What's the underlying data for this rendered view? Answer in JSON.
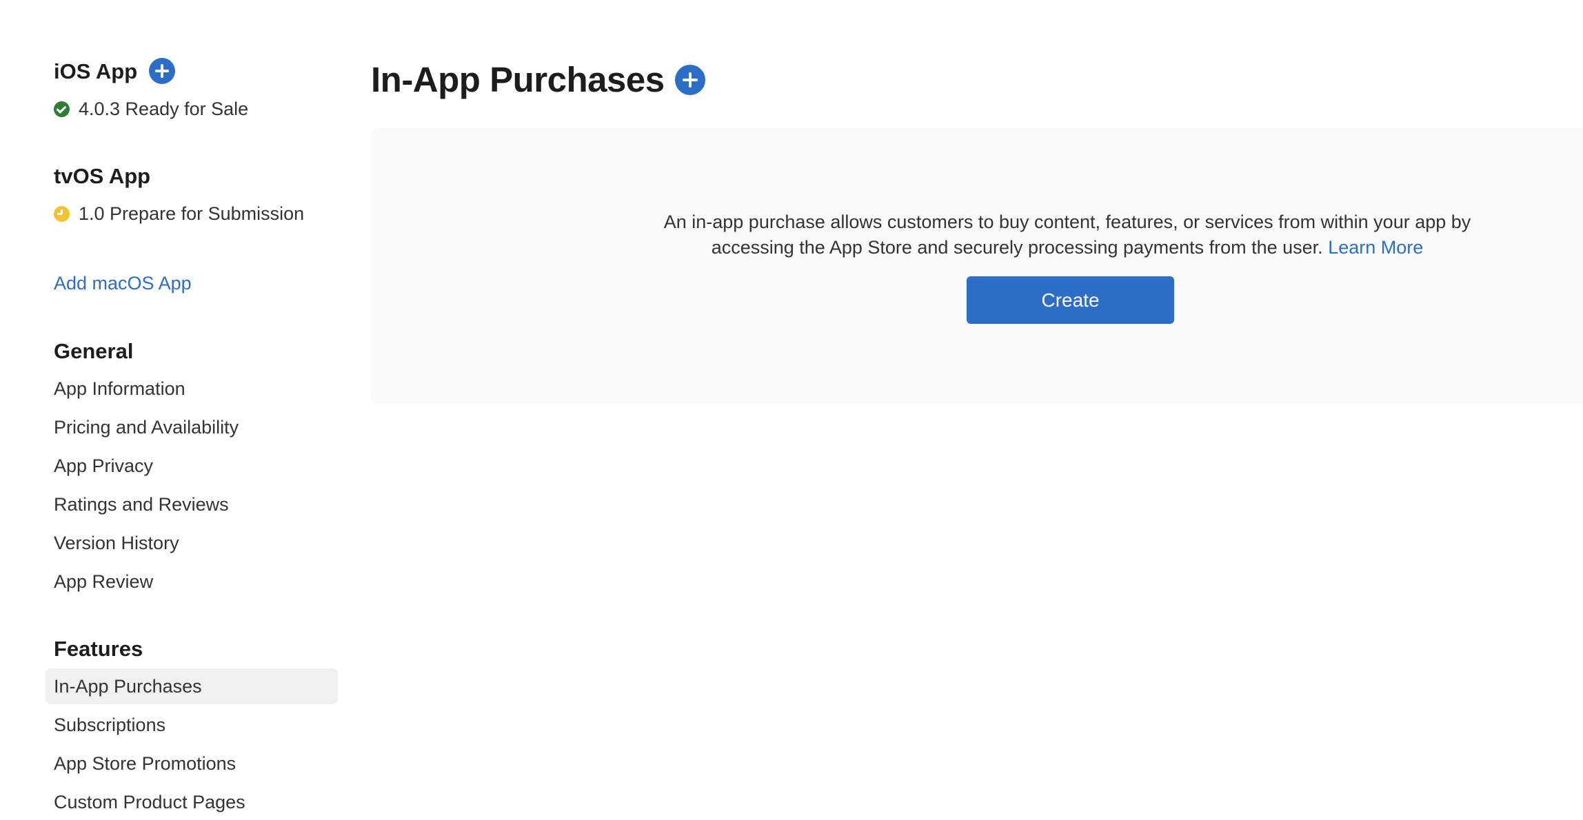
{
  "sidebar": {
    "ios_app": {
      "title": "iOS App",
      "add_icon": "plus-circle-icon",
      "status_icon": "checkmark-circle-icon",
      "status_color": "#2f7d32",
      "status_text": "4.0.3 Ready for Sale"
    },
    "tvos_app": {
      "title": "tvOS App",
      "status_icon": "clock-circle-icon",
      "status_color": "#f2c230",
      "status_text": "1.0 Prepare for Submission"
    },
    "add_macos_link": "Add macOS App",
    "general": {
      "title": "General",
      "items": [
        {
          "label": "App Information"
        },
        {
          "label": "Pricing and Availability"
        },
        {
          "label": "App Privacy"
        },
        {
          "label": "Ratings and Reviews"
        },
        {
          "label": "Version History"
        },
        {
          "label": "App Review"
        }
      ]
    },
    "features": {
      "title": "Features",
      "items": [
        {
          "label": "In-App Purchases",
          "active": true
        },
        {
          "label": "Subscriptions"
        },
        {
          "label": "App Store Promotions"
        },
        {
          "label": "Custom Product Pages"
        }
      ]
    }
  },
  "main": {
    "title": "In-App Purchases",
    "add_icon": "plus-circle-icon",
    "empty_state": {
      "description": "An in-app purchase allows customers to buy content, features, or services from within your app by accessing the App Store and securely processing payments from the user.",
      "learn_more": "Learn More",
      "create_button": "Create"
    }
  },
  "colors": {
    "accent": "#2c6ec7",
    "panel_background": "#f9f9f9",
    "active_nav_background": "#f0f0f0"
  }
}
